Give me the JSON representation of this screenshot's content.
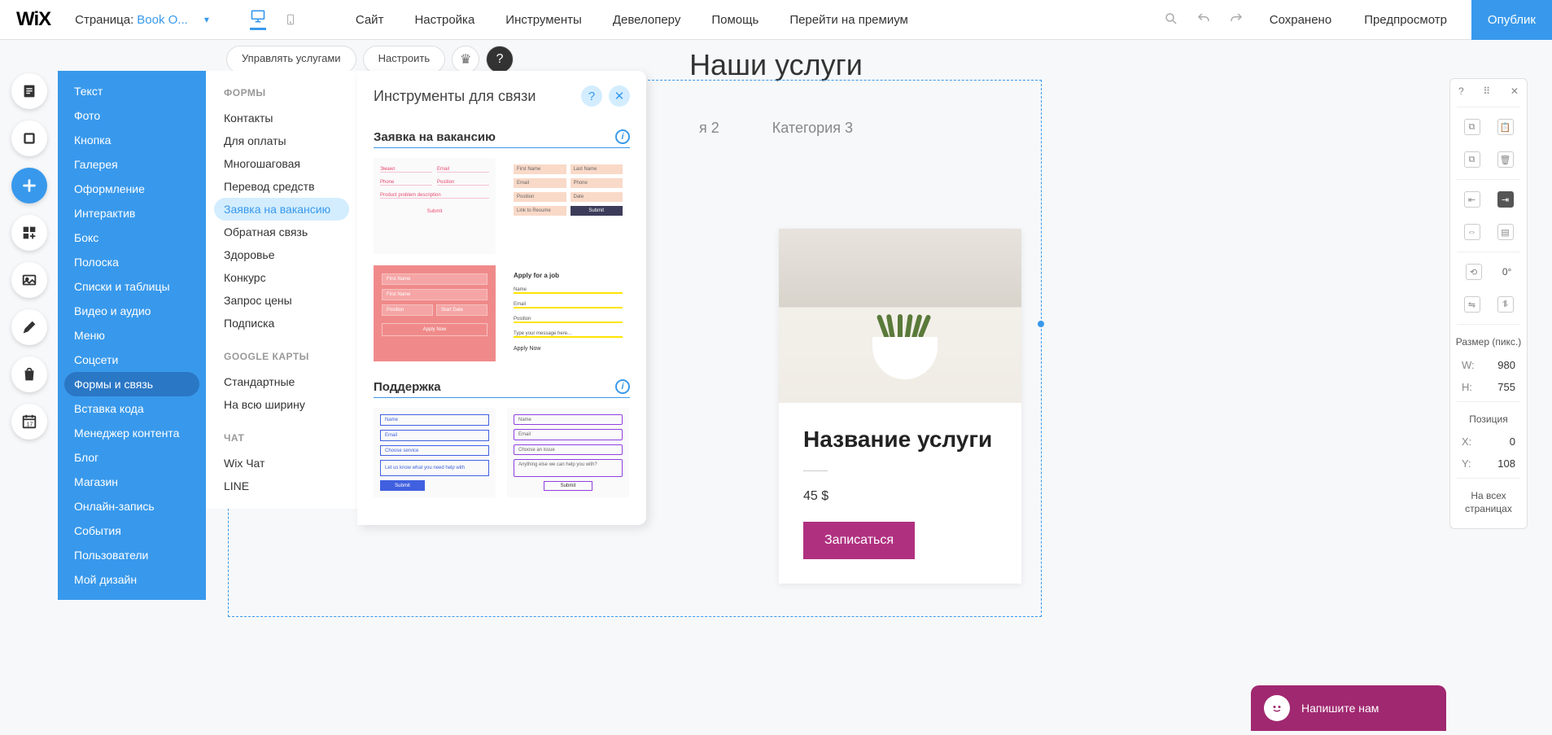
{
  "topbar": {
    "logo": "WiX",
    "page_label": "Страница:",
    "page_name": "Book O...",
    "menu": [
      "Сайт",
      "Настройка",
      "Инструменты",
      "Девелоперу",
      "Помощь",
      "Перейти на премиум"
    ],
    "saved": "Сохранено",
    "preview": "Предпросмотр",
    "publish": "Опублик"
  },
  "float_toolbar": {
    "manage": "Управлять услугами",
    "configure": "Настроить"
  },
  "panel1": {
    "items": [
      "Текст",
      "Фото",
      "Кнопка",
      "Галерея",
      "Оформление",
      "Интерактив",
      "Бокс",
      "Полоска",
      "Списки и таблицы",
      "Видео и аудио",
      "Меню",
      "Соцсети",
      "Формы и связь",
      "Вставка кода",
      "Менеджер контента",
      "Блог",
      "Магазин",
      "Онлайн-запись",
      "События",
      "Пользователи",
      "Мой дизайн"
    ],
    "active_index": 12
  },
  "panel2": {
    "groups": [
      {
        "header": "ФОРМЫ",
        "items": [
          "Контакты",
          "Для оплаты",
          "Многошаговая",
          "Перевод средств",
          "Заявка на вакансию",
          "Обратная связь",
          "Здоровье",
          "Конкурс",
          "Запрос цены",
          "Подписка"
        ],
        "active_index": 4
      },
      {
        "header": "GOOGLE КАРТЫ",
        "items": [
          "Стандартные",
          "На всю ширину"
        ]
      },
      {
        "header": "ЧАТ",
        "items": [
          "Wix Чат",
          "LINE"
        ]
      }
    ]
  },
  "panel3": {
    "title": "Инструменты для связи",
    "sections": [
      {
        "title": "Заявка на вакансию"
      },
      {
        "title": "Поддержка"
      }
    ],
    "previews": {
      "p1": {
        "f1": "Эмаил",
        "f2": "Email",
        "f3": "Phone",
        "f4": "Position",
        "f5": "Product problem description",
        "submit": "Submit"
      },
      "p2": {
        "f1": "First Name",
        "f2": "Last Name",
        "f3": "Email",
        "f4": "Phone",
        "f5": "Position",
        "f6": "Date",
        "f7": "Link to Resume",
        "submit": "Submit"
      },
      "p3": {
        "f1": "First Name",
        "f2": "First Name",
        "f3": "Position",
        "f4": "Start Date",
        "apply": "Apply Now"
      },
      "p4": {
        "title": "Apply for a job",
        "f1": "Name",
        "f2": "Email",
        "f3": "Position",
        "f4": "Type your message here...",
        "apply": "Apply Now"
      },
      "p5": {
        "f1": "Name",
        "f2": "Email",
        "f3": "Choose service",
        "f4": "Let us know what you need help with",
        "submit": "Submit"
      },
      "p6": {
        "f1": "Name",
        "f2": "Email",
        "f3": "Choose an issue",
        "f4": "Anything else we can help you with?",
        "submit": "Submit"
      }
    }
  },
  "canvas": {
    "heading": "Наши услуги",
    "tab2": "я 2",
    "tab3": "Категория 3",
    "card": {
      "title": "Название услуги",
      "price": "45 $",
      "button": "Записаться"
    }
  },
  "chat": {
    "line1": "Напишите нам"
  },
  "inspector": {
    "rotation": "0°",
    "size_label": "Размер (пикс.)",
    "w_label": "W:",
    "w": "980",
    "h_label": "H:",
    "h": "755",
    "pos_label": "Позиция",
    "x_label": "X:",
    "x": "0",
    "y_label": "Y:",
    "y": "108",
    "all_pages": "На всех страницах"
  }
}
